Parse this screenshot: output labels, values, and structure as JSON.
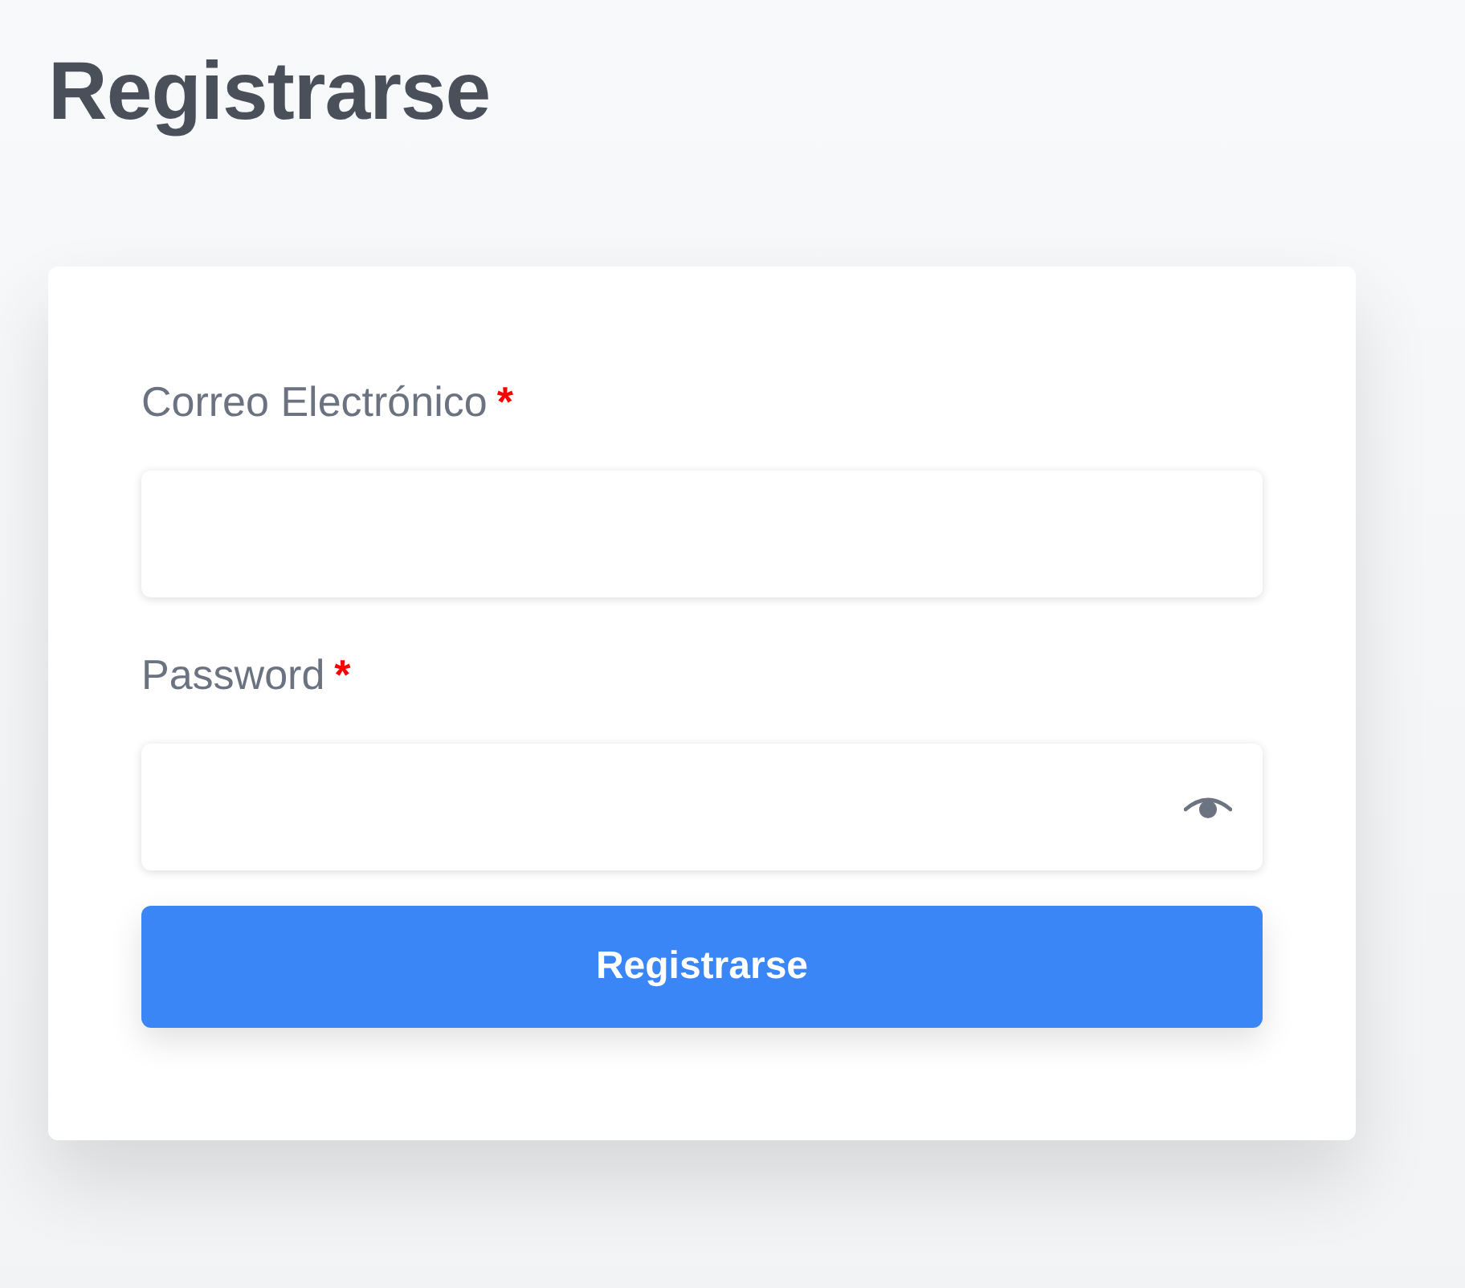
{
  "page": {
    "title": "Registrarse"
  },
  "form": {
    "fields": [
      {
        "kind": "email",
        "label": "Correo Electrónico",
        "required_mark": "*"
      },
      {
        "kind": "password",
        "label": "Password",
        "required_mark": "*"
      }
    ],
    "submit": {
      "label": "Registrarse"
    }
  }
}
